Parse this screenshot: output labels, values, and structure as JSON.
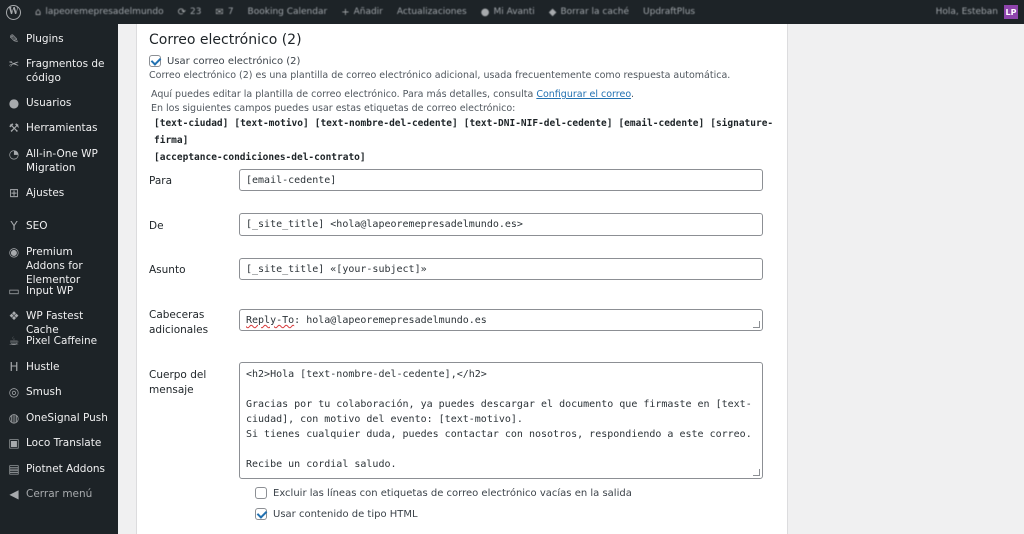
{
  "adminbar": {
    "items": [
      "lapeoremepresadelmundo",
      "23",
      "7",
      "Booking Calendar",
      "Añadir",
      "Actualizaciones",
      "Mi Avanti",
      "Borrar la caché",
      "UpdraftPlus"
    ],
    "greeting": "Hola, Esteban",
    "avatar_label": "LP"
  },
  "sidebar": {
    "items": [
      {
        "label": "Plugins",
        "icon": "plugin-icon"
      },
      {
        "label": "Fragmentos de código",
        "icon": "scissors-icon"
      },
      {
        "label": "Usuarios",
        "icon": "users-icon"
      },
      {
        "label": "Herramientas",
        "icon": "wrench-icon"
      },
      {
        "label": "All-in-One WP Migration",
        "icon": "migration-icon"
      },
      {
        "label": "Ajustes",
        "icon": "settings-icon"
      },
      {
        "label": "SEO",
        "icon": "yoast-icon"
      },
      {
        "label": "Premium Addons for Elementor",
        "icon": "premium-addons-icon"
      },
      {
        "label": "Input WP",
        "icon": "input-icon"
      },
      {
        "label": "WP Fastest Cache",
        "icon": "cheetah-icon"
      },
      {
        "label": "Pixel Caffeine",
        "icon": "coffee-icon"
      },
      {
        "label": "Hustle",
        "icon": "hustle-icon"
      },
      {
        "label": "Smush",
        "icon": "smush-icon"
      },
      {
        "label": "OneSignal Push",
        "icon": "bell-icon"
      },
      {
        "label": "Loco Translate",
        "icon": "translate-icon"
      },
      {
        "label": "Piotnet Addons",
        "icon": "piotnet-icon"
      },
      {
        "label": "Cerrar menú",
        "icon": "collapse-icon"
      }
    ]
  },
  "mail2": {
    "heading": "Correo electrónico (2)",
    "use_label": "Usar correo electrónico (2)",
    "use_desc": "Correo electrónico (2) es una plantilla de correo electrónico adicional, usada frecuentemente como respuesta automática.",
    "info_line1": "Aquí puedes editar la plantilla de correo electrónico. Para más detalles, consulta",
    "info_link": "Configurar el correo",
    "info_line2": "En los siguientes campos puedes usar estas etiquetas de correo electrónico:",
    "tags": [
      "[text-ciudad]",
      "[text-motivo]",
      "[text-nombre-del-cedente]",
      "[text-DNI-NIF-del-cedente]",
      "[email-cedente]",
      "[signature-firma]",
      "[acceptance-condiciones-del-contrato]"
    ],
    "to_label": "Para",
    "to_value": "[email-cedente]",
    "from_label": "De",
    "from_value": "[_site_title] <hola@lapeoremepresadelmundo.es>",
    "subject_label": "Asunto",
    "subject_value": "[_site_title] «[your-subject]»",
    "headers_label": "Cabeceras adicionales",
    "headers_key": "Reply-To",
    "headers_rest": ": hola@lapeoremepresadelmundo.es",
    "body_label": "Cuerpo del mensaje",
    "body_lines": [
      "<h2>Hola [text-nombre-del-cedente],</h2>",
      "",
      "Gracias por tu colaboración, ya puedes descargar el documento que firmaste en [text-",
      "ciudad], con motivo del evento: [text-motivo].",
      "Si tienes cualquier duda, puedes contactar con nosotros, respondiendo a este correo.",
      "",
      "Recibe un cordial saludo."
    ],
    "exclude_label": "Excluir las líneas con etiquetas de correo electrónico vacías en la salida",
    "html_label": "Usar contenido de tipo HTML"
  }
}
